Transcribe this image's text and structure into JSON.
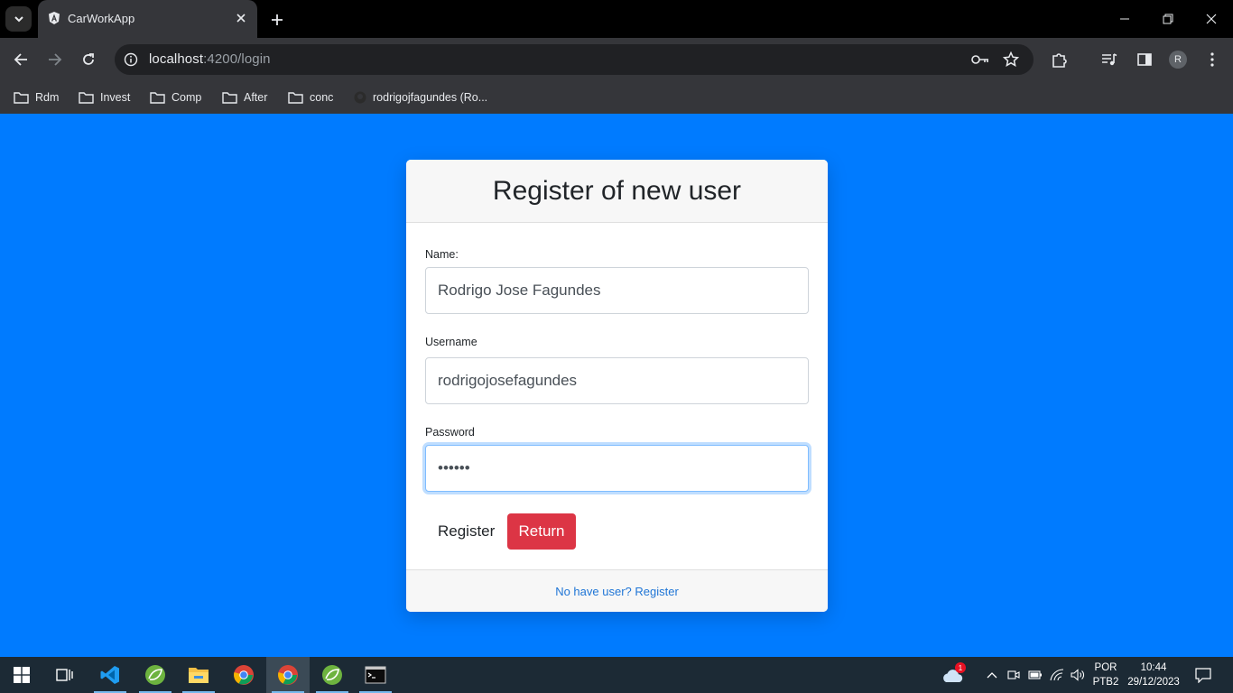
{
  "browser": {
    "tab_title": "CarWorkApp",
    "url_host": "localhost",
    "url_path": ":4200/login",
    "profile_initial": "R",
    "bookmarks": [
      {
        "label": "Rdm"
      },
      {
        "label": "Invest"
      },
      {
        "label": "Comp"
      },
      {
        "label": "After"
      },
      {
        "label": "conc"
      },
      {
        "label": "rodrigojfagundes (Ro..."
      }
    ]
  },
  "form": {
    "title": "Register of new user",
    "name_label": "Name:",
    "name_value": "Rodrigo Jose Fagundes",
    "username_label": "Username",
    "username_value": "rodrigojosefagundes",
    "password_label": "Password",
    "password_value": "••••••",
    "register_button": "Register",
    "return_button": "Return",
    "footer_link": "No have user? Register"
  },
  "colors": {
    "page_background": "#007bff",
    "return_button": "#dc3545"
  },
  "taskbar": {
    "apps": [
      "start-icon",
      "task-view-icon",
      "vscode-icon",
      "spring-tool-icon",
      "file-explorer-icon",
      "chrome-icon",
      "chrome-icon",
      "spring-tool-icon",
      "terminal-icon"
    ],
    "weather_badge": "1",
    "language": "POR",
    "layout": "PTB2",
    "time": "10:44",
    "date": "29/12/2023"
  }
}
